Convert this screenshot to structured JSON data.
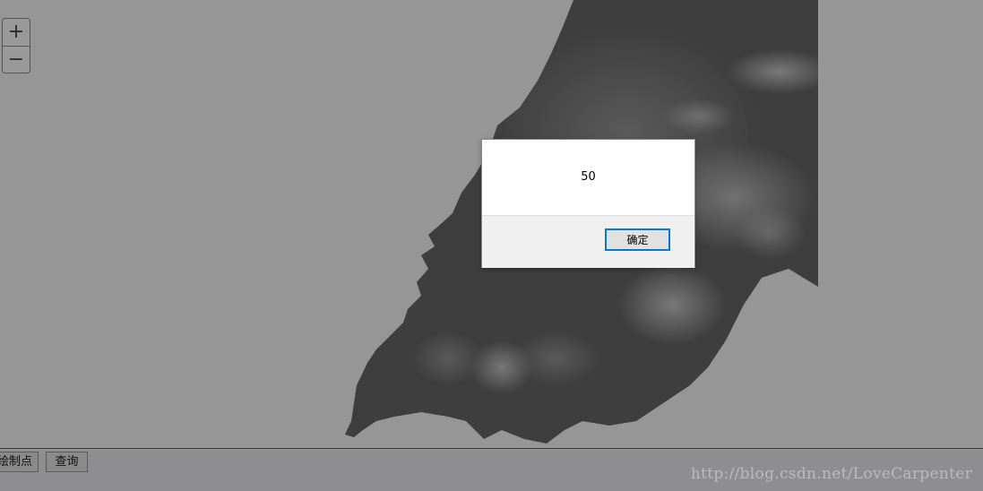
{
  "map": {
    "zoom_in_label": "+",
    "zoom_out_label": "−"
  },
  "toolbar": {
    "draw_point_label": "绘制点",
    "query_label": "查询"
  },
  "watermark": "http://blog.csdn.net/LoveCarpenter",
  "dialog": {
    "message": "50",
    "ok_label": "确定"
  }
}
